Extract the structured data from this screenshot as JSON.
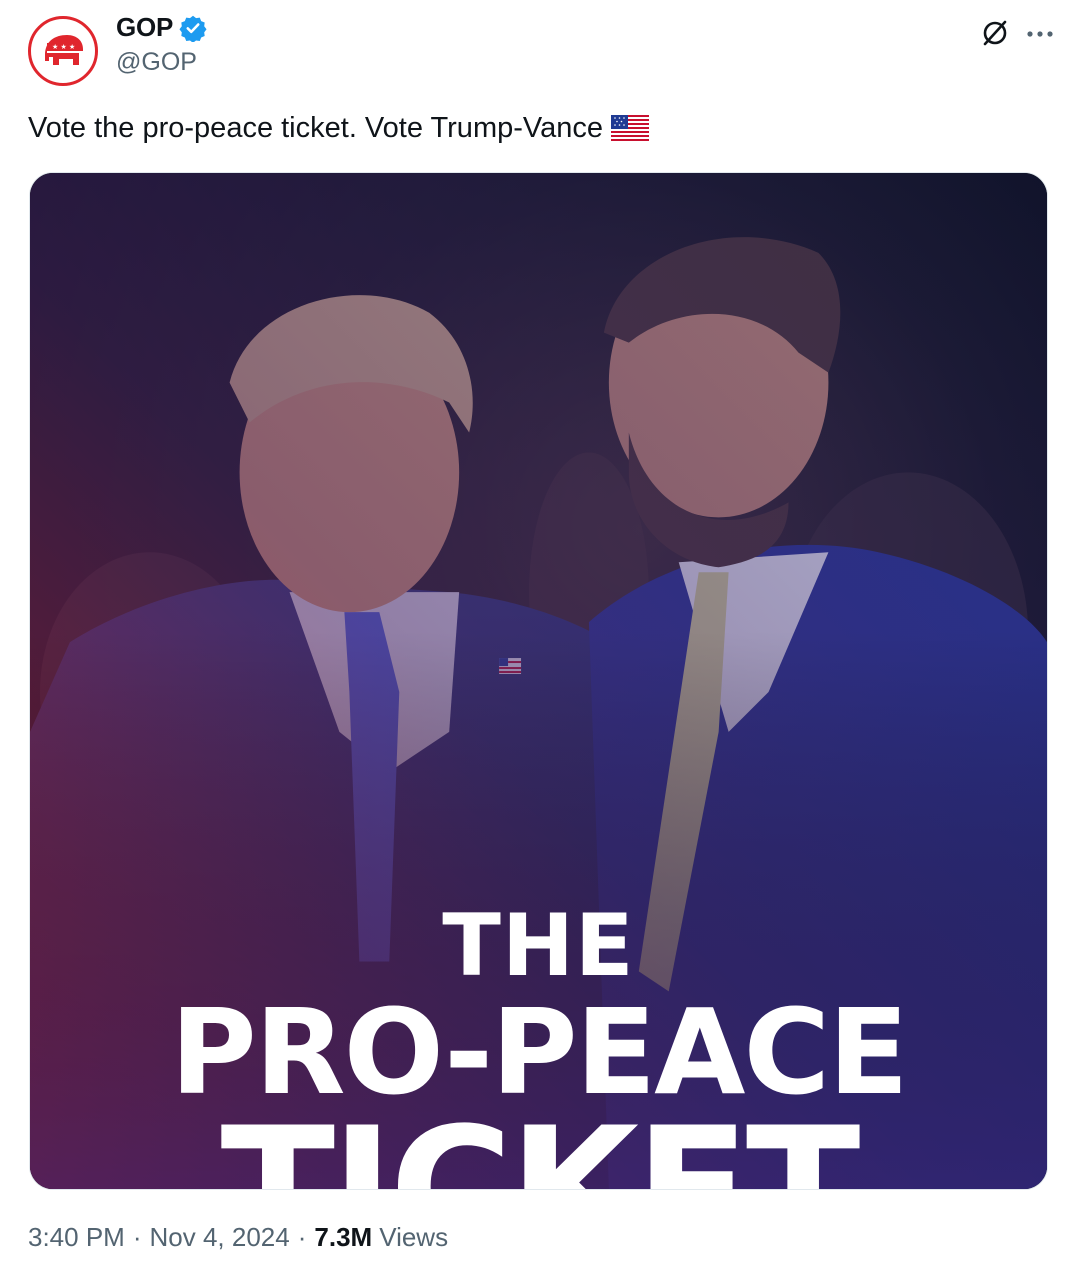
{
  "author": {
    "display_name": "GOP",
    "handle": "@GOP",
    "verified_icon": "verified-badge-icon",
    "avatar_icon": "republican-elephant-logo"
  },
  "tweet": {
    "text": "Vote the pro-peace ticket. Vote Trump-Vance",
    "emoji": "us-flag-emoji"
  },
  "media": {
    "overlay_line1": "THE",
    "overlay_line2": "PRO-PEACE",
    "overlay_line3": "TICKET"
  },
  "meta": {
    "time": "3:40 PM",
    "separator": "·",
    "date": "Nov 4, 2024",
    "views_count": "7.3M",
    "views_label": "Views"
  },
  "colors": {
    "brand_red": "#e0262d",
    "verified_blue": "#1d9bf0",
    "secondary_text": "#536471"
  },
  "icons": {
    "grok": "grok-icon",
    "more": "more-options-icon"
  }
}
